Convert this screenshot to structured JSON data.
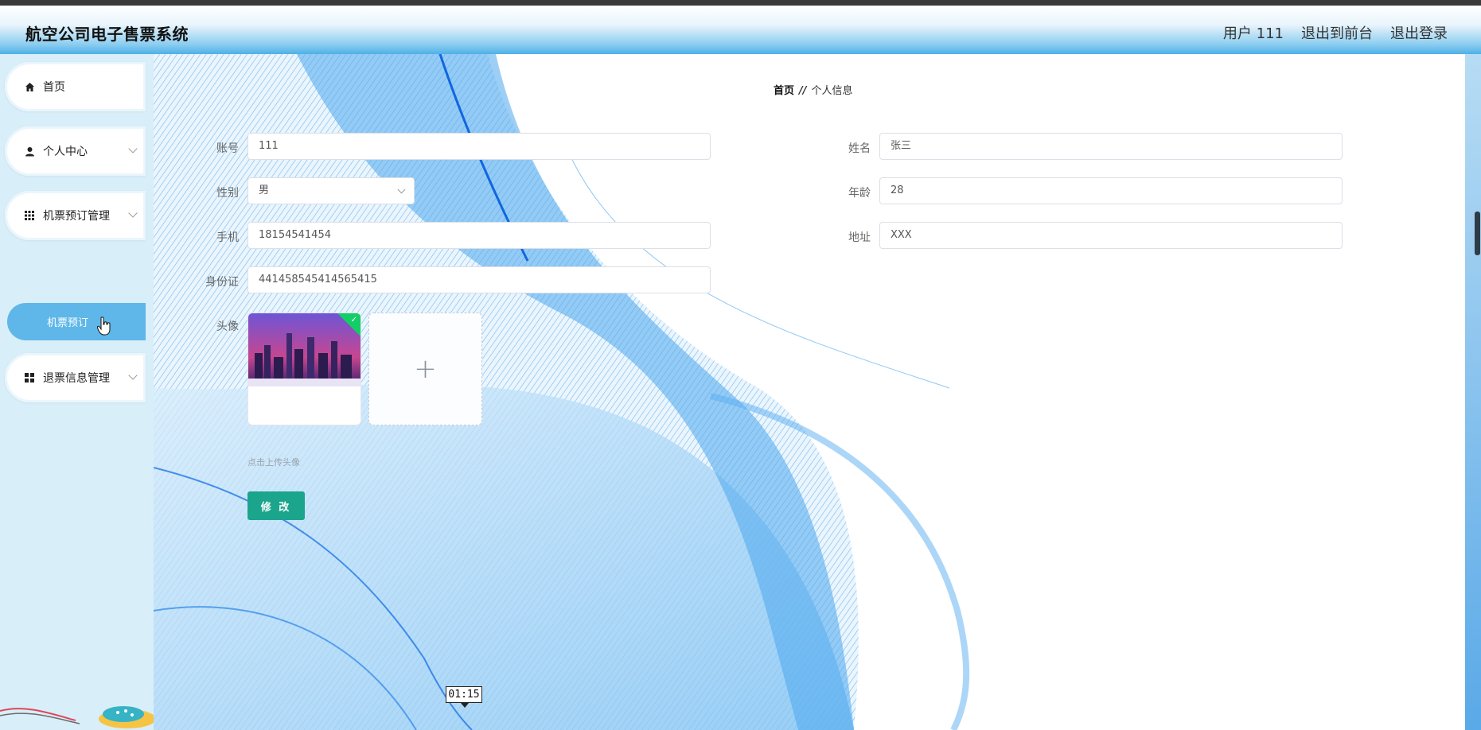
{
  "header": {
    "title": "航空公司电子售票系统",
    "user": "用户 111",
    "back_to_front": "退出到前台",
    "logout": "退出登录"
  },
  "sidebar": {
    "items": [
      {
        "label": "首页",
        "icon": "home-icon"
      },
      {
        "label": "个人中心",
        "icon": "user-icon"
      },
      {
        "label": "机票预订管理",
        "icon": "grid-icon"
      },
      {
        "label": "退票信息管理",
        "icon": "apps-icon"
      }
    ],
    "active_sub": "机票预订"
  },
  "breadcrumb": {
    "home": "首页",
    "sep": "//",
    "current": "个人信息"
  },
  "form": {
    "account": {
      "label": "账号",
      "value": "111"
    },
    "gender": {
      "label": "性别",
      "value": "男"
    },
    "phone": {
      "label": "手机",
      "value": "18154541454"
    },
    "id_card": {
      "label": "身份证",
      "value": "441458545414565415"
    },
    "avatar": {
      "label": "头像",
      "hint": "点击上传头像"
    },
    "name": {
      "label": "姓名",
      "value": "张三"
    },
    "age": {
      "label": "年龄",
      "value": "28"
    },
    "address": {
      "label": "地址",
      "value": "XXX"
    },
    "submit_label": "修 改"
  },
  "overlay": {
    "time": "01:15"
  },
  "colors": {
    "accent": "#5eb7e8",
    "button": "#1aa58c",
    "success": "#13ce66"
  }
}
